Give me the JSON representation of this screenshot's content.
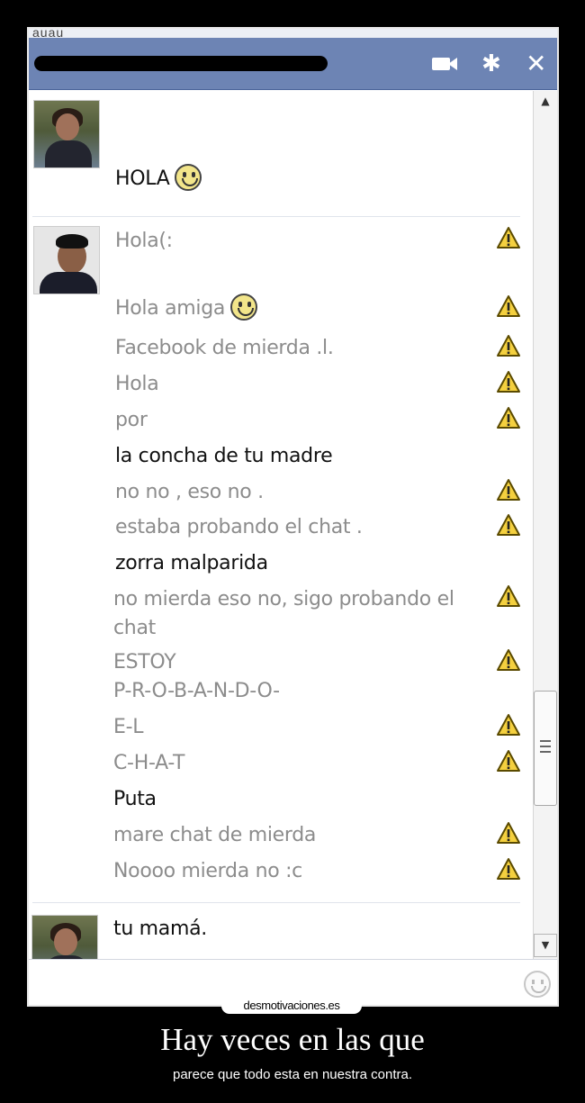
{
  "window": {
    "top_partial_text": "auau"
  },
  "messages": [
    {
      "id": "m1",
      "text": "HOLA",
      "style": "dark",
      "smiley": true,
      "warning": false
    },
    {
      "id": "m2",
      "text": "Hola(:",
      "style": "sent",
      "smiley": false,
      "warning": true
    },
    {
      "id": "m3",
      "text": "Hola amiga",
      "style": "sent",
      "smiley": true,
      "warning": true
    },
    {
      "id": "m4",
      "text": "Facebook de mierda .l.",
      "style": "sent",
      "smiley": false,
      "warning": true
    },
    {
      "id": "m5",
      "text": "Hola",
      "style": "sent",
      "smiley": false,
      "warning": true
    },
    {
      "id": "m6",
      "text": "por",
      "style": "sent",
      "smiley": false,
      "warning": true
    },
    {
      "id": "m7",
      "text": "la concha de tu madre",
      "style": "dark",
      "smiley": false,
      "warning": false
    },
    {
      "id": "m8",
      "text": "no no , eso no .",
      "style": "sent",
      "smiley": false,
      "warning": true
    },
    {
      "id": "m9",
      "text": "estaba probando el chat .",
      "style": "sent",
      "smiley": false,
      "warning": true
    },
    {
      "id": "m10",
      "text": "zorra malparida",
      "style": "dark",
      "smiley": false,
      "warning": false
    },
    {
      "id": "m11",
      "text": "no mierda eso  no, sigo probando el chat",
      "style": "sent",
      "smiley": false,
      "warning": true
    },
    {
      "id": "m12",
      "text": "ESTOY",
      "style": "sent",
      "smiley": false,
      "warning": true
    },
    {
      "id": "m13",
      "text": "P-R-O-B-A-N-D-O-",
      "style": "sent",
      "smiley": false,
      "warning": false
    },
    {
      "id": "m14",
      "text": "E-L",
      "style": "sent",
      "smiley": false,
      "warning": true
    },
    {
      "id": "m15",
      "text": "C-H-A-T",
      "style": "sent",
      "smiley": false,
      "warning": true
    },
    {
      "id": "m16",
      "text": "Puta",
      "style": "dark",
      "smiley": false,
      "warning": false
    },
    {
      "id": "m17",
      "text": "mare chat de mierda",
      "style": "sent",
      "smiley": false,
      "warning": true
    },
    {
      "id": "m18",
      "text": "Noooo mierda no :c",
      "style": "sent",
      "smiley": false,
      "warning": true
    },
    {
      "id": "m19",
      "text": "tu mamá.",
      "style": "dark",
      "smiley": false,
      "warning": false
    }
  ],
  "icons": {
    "video": "video-camera-icon",
    "settings": "gear-icon",
    "close": "close-icon",
    "warning": "warning-triangle-icon",
    "smiley": "smiley-icon",
    "emoji": "emoji-icon"
  },
  "colors": {
    "titlebar": "#6d84b4",
    "sent_text": "#8c8c8c",
    "dark_text": "#111111",
    "warning_fill": "#f4d03f"
  },
  "watermark": "desmotivaciones.es",
  "caption": {
    "title": "Hay veces en las que",
    "subtitle": "parece que todo esta en nuestra contra."
  }
}
